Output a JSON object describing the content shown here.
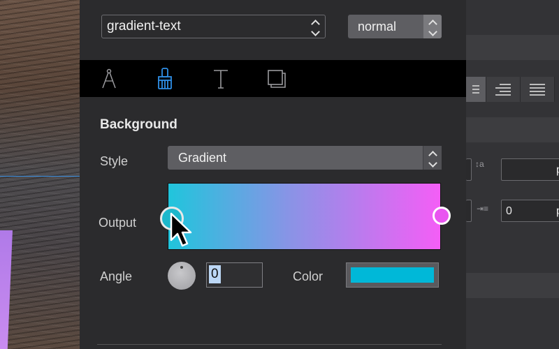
{
  "layer_selector": {
    "value": "gradient-text"
  },
  "blend_mode": {
    "value": "normal"
  },
  "tabs": [
    {
      "icon": "compass-icon",
      "active": false
    },
    {
      "icon": "paint-brush-icon",
      "active": true
    },
    {
      "icon": "text-icon",
      "active": false
    },
    {
      "icon": "shadow-icon",
      "active": false
    }
  ],
  "background": {
    "title": "Background",
    "style_label": "Style",
    "style_value": "Gradient",
    "output_label": "Output",
    "gradient": {
      "start_color": "#20c5dc",
      "end_color": "#f45ef6"
    },
    "angle_label": "Angle",
    "angle_value": "0",
    "color_label": "Color",
    "selected_color": "#00b8d8"
  },
  "right_panel": {
    "field_1_suffix": "p",
    "field_2_value": "0",
    "field_2_suffix": "p",
    "baseline_icon_text": "a"
  },
  "colors": {
    "accent": "#2f8fe6",
    "panel_bg": "#2b2b2d",
    "toolbar_bg": "#000000"
  }
}
